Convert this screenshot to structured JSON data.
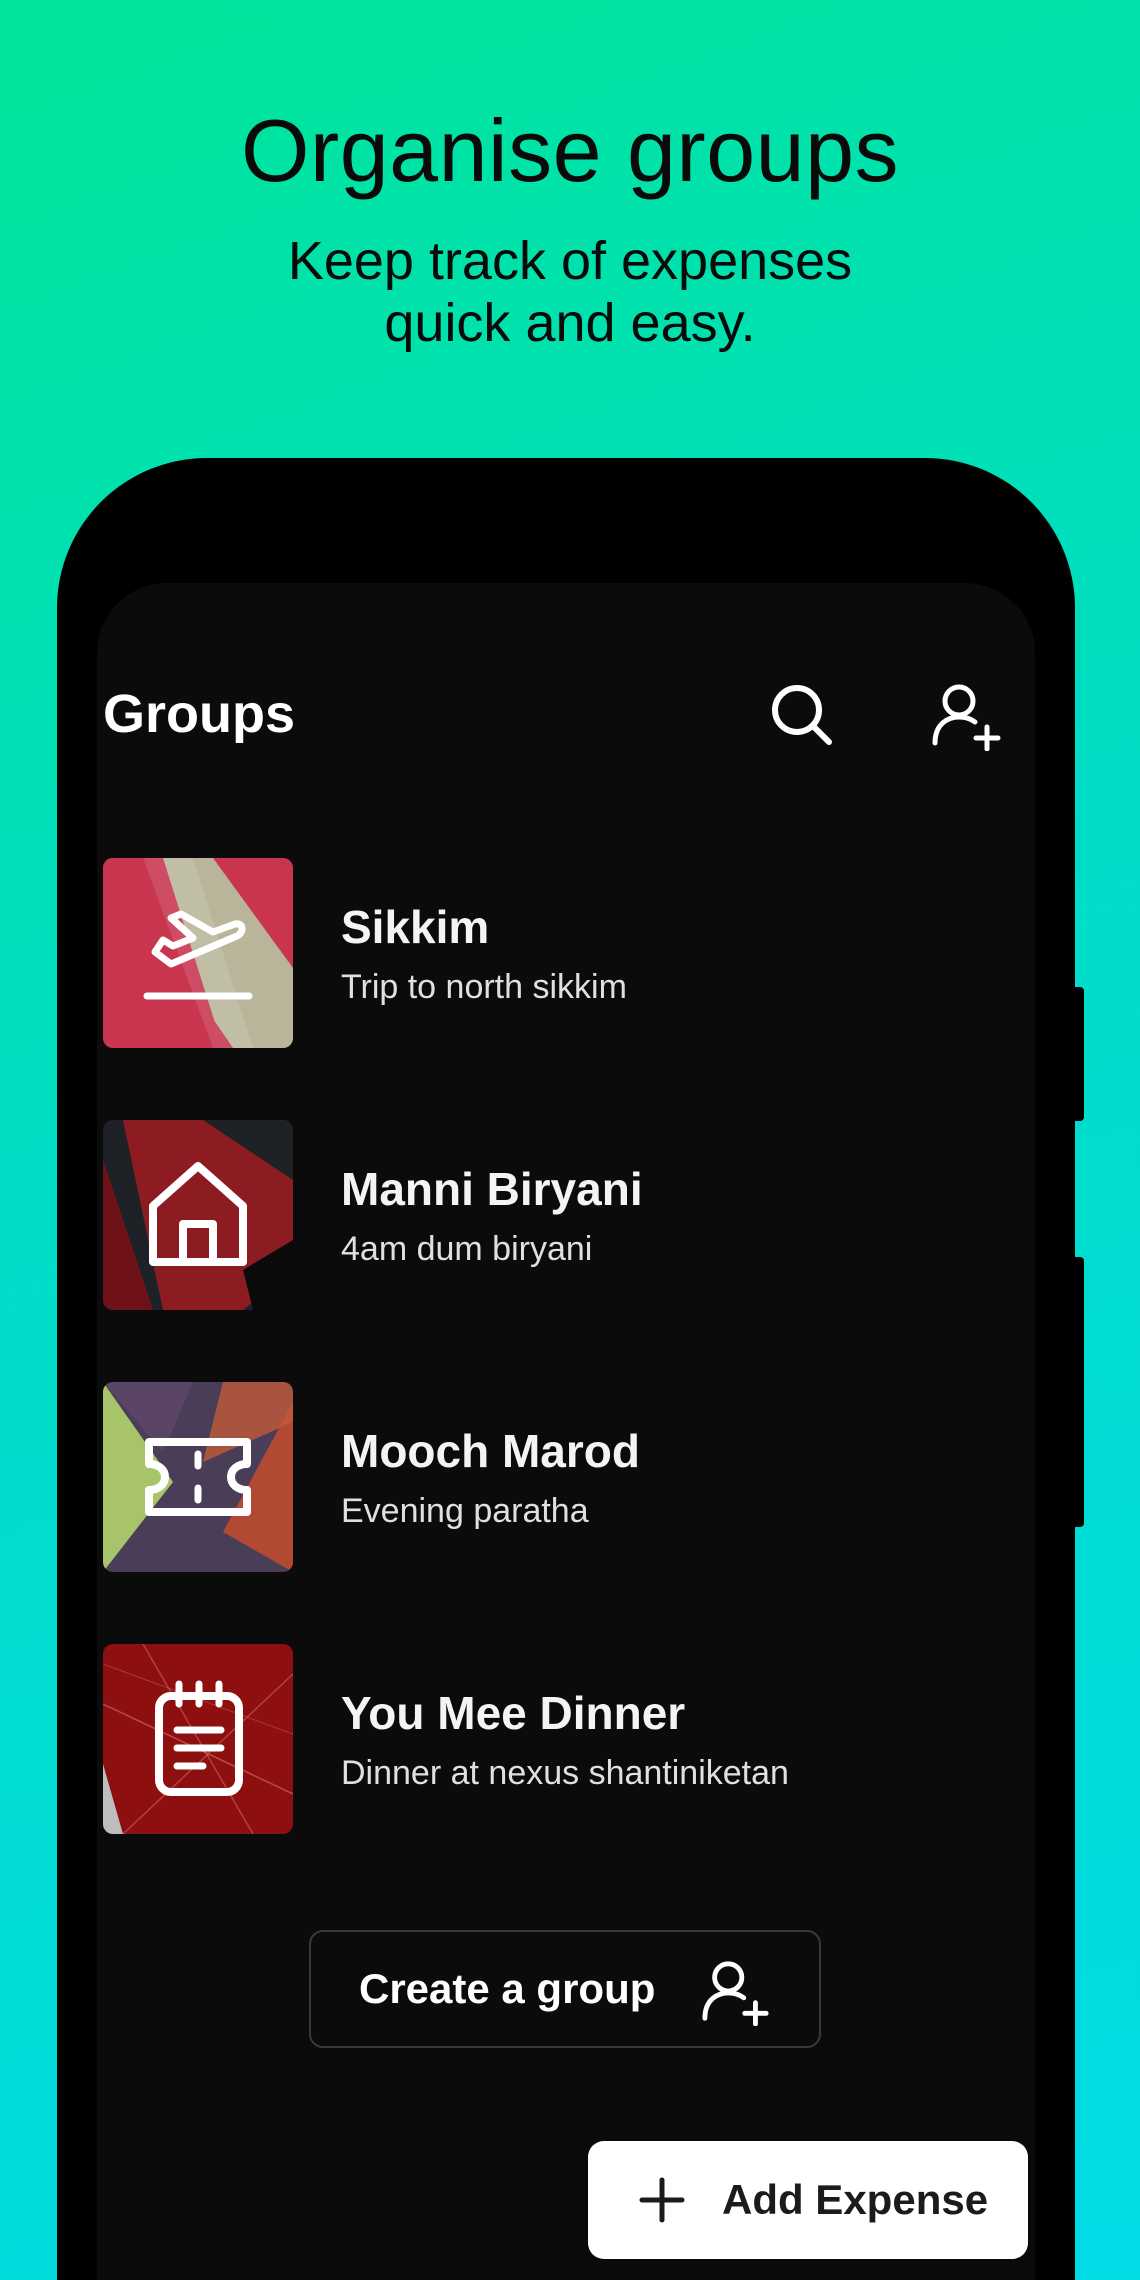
{
  "hero": {
    "title": "Organise groups",
    "subtitle_line1": "Keep track of expenses",
    "subtitle_line2": "quick and easy."
  },
  "app": {
    "title": "Groups",
    "icons": [
      "search-icon",
      "add-person-icon"
    ]
  },
  "groups": [
    {
      "name": "Sikkim",
      "description": "Trip to north sikkim",
      "icon": "flight-takeoff-icon",
      "colors": [
        "#C9354F",
        "#B9B59A"
      ]
    },
    {
      "name": "Manni Biryani",
      "description": "4am dum biryani",
      "icon": "home-icon",
      "colors": [
        "#8C1C22",
        "#1E2126"
      ]
    },
    {
      "name": "Mooch Marod",
      "description": "Evening paratha",
      "icon": "ticket-icon",
      "colors": [
        "#4A3D57",
        "#A8C46A",
        "#B24A33"
      ]
    },
    {
      "name": "You Mee Dinner",
      "description": "Dinner at nexus shantiniketan",
      "icon": "notepad-icon",
      "colors": [
        "#8E0F0F",
        "#B81B1B"
      ]
    }
  ],
  "create_button": {
    "label": "Create a group",
    "icon": "add-person-icon"
  },
  "fab": {
    "label": "Add Expense",
    "icon": "plus-icon"
  },
  "colors": {
    "background_start": "#00E59A",
    "background_end": "#00DCE6",
    "screen_bg": "#0B0B0C",
    "text_light": "#FFFFFF"
  }
}
